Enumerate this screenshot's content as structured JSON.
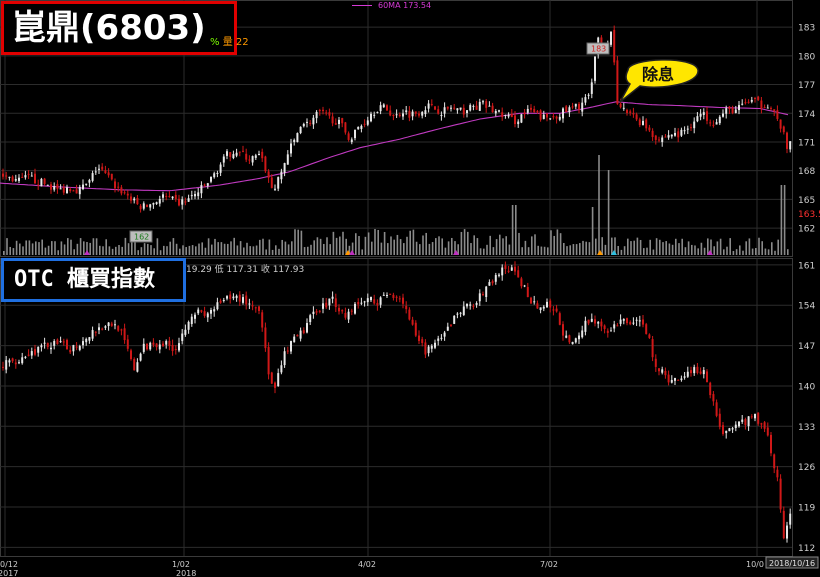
{
  "title_box": {
    "label": "崑鼎(6803)"
  },
  "otc_box": {
    "label": "OTC 櫃買指數"
  },
  "top_legend": {
    "ma_label": "60MA 173.54",
    "pct_symbol": "%",
    "vol_label": "量 22"
  },
  "otc_legend": {
    "text": "19.29 低 117.31 收 117.93"
  },
  "annotation": {
    "text": "除息"
  },
  "dates": {
    "x_labels": [
      "0/12",
      "1/02",
      "4/02",
      "7/02",
      "10/0"
    ],
    "x_year_labels": [
      "2017",
      "2018"
    ],
    "cursor_date": "2018/10/16"
  },
  "colors": {
    "up": "#e8e8e8",
    "down": "#d01818",
    "ma": "#c03ac0",
    "volume": "#8a8a8a",
    "grid": "#2c2c2c",
    "axis_text": "#cfcfcf"
  },
  "chart_data": [
    {
      "type": "candlestick",
      "name": "崑鼎(6803) daily",
      "ylim": [
        159.5,
        185
      ],
      "yticks": [
        162,
        165,
        168,
        171,
        174,
        177,
        180,
        183
      ],
      "price_tag": "163.5",
      "max_label": "183",
      "min_label": "162",
      "ma_label": "60MA 173.54",
      "close_points": [
        [
          0,
          167.6
        ],
        [
          10,
          167.2
        ],
        [
          18,
          166.9
        ],
        [
          28,
          167.3
        ],
        [
          38,
          166.8
        ],
        [
          48,
          166.5
        ],
        [
          58,
          165.9
        ],
        [
          68,
          166.3
        ],
        [
          78,
          166.0
        ],
        [
          88,
          166.7
        ],
        [
          96,
          168.4
        ],
        [
          106,
          167.4
        ],
        [
          116,
          166.2
        ],
        [
          126,
          165.5
        ],
        [
          134,
          164.6
        ],
        [
          140,
          164.2
        ],
        [
          146,
          164.3
        ],
        [
          154,
          164.8
        ],
        [
          162,
          165.3
        ],
        [
          170,
          164.9
        ],
        [
          178,
          164.6
        ],
        [
          186,
          164.9
        ],
        [
          194,
          165.5
        ],
        [
          202,
          166.2
        ],
        [
          210,
          167.1
        ],
        [
          218,
          168.4
        ],
        [
          226,
          169.6
        ],
        [
          234,
          170.2
        ],
        [
          242,
          169.6
        ],
        [
          250,
          169.2
        ],
        [
          258,
          169.5
        ],
        [
          264,
          168.4
        ],
        [
          270,
          166.2
        ],
        [
          276,
          166.5
        ],
        [
          282,
          168.4
        ],
        [
          288,
          170.1
        ],
        [
          294,
          171.2
        ],
        [
          300,
          173.1
        ],
        [
          306,
          172.9
        ],
        [
          312,
          173.4
        ],
        [
          318,
          174.1
        ],
        [
          326,
          173.6
        ],
        [
          334,
          173.3
        ],
        [
          342,
          172.5
        ],
        [
          350,
          171.2
        ],
        [
          356,
          172.4
        ],
        [
          362,
          172.9
        ],
        [
          370,
          174.0
        ],
        [
          378,
          174.7
        ],
        [
          386,
          174.4
        ],
        [
          394,
          173.6
        ],
        [
          402,
          174.3
        ],
        [
          410,
          173.9
        ],
        [
          418,
          174.2
        ],
        [
          426,
          174.8
        ],
        [
          434,
          174.5
        ],
        [
          442,
          174.2
        ],
        [
          450,
          174.6
        ],
        [
          458,
          174.1
        ],
        [
          466,
          174.4
        ],
        [
          474,
          174.7
        ],
        [
          482,
          174.9
        ],
        [
          490,
          174.4
        ],
        [
          498,
          174.0
        ],
        [
          506,
          173.6
        ],
        [
          514,
          173.2
        ],
        [
          522,
          173.9
        ],
        [
          530,
          174.2
        ],
        [
          538,
          173.7
        ],
        [
          546,
          173.4
        ],
        [
          554,
          173.8
        ],
        [
          562,
          174.1
        ],
        [
          570,
          174.4
        ],
        [
          578,
          174.8
        ],
        [
          584,
          175.4
        ],
        [
          588,
          175.8
        ],
        [
          591,
          176.9
        ],
        [
          593,
          178.5
        ],
        [
          596,
          182.2
        ],
        [
          600,
          181.5
        ],
        [
          604,
          180.8
        ],
        [
          609,
          182.4
        ],
        [
          612,
          181.9
        ],
        [
          616,
          174.6
        ],
        [
          622,
          174.3
        ],
        [
          628,
          173.9
        ],
        [
          634,
          173.5
        ],
        [
          640,
          173.1
        ],
        [
          646,
          172.6
        ],
        [
          652,
          171.8
        ],
        [
          658,
          171.3
        ],
        [
          664,
          171.5
        ],
        [
          670,
          171.9
        ],
        [
          676,
          171.6
        ],
        [
          682,
          172.1
        ],
        [
          688,
          172.6
        ],
        [
          694,
          173.4
        ],
        [
          700,
          173.9
        ],
        [
          706,
          173.6
        ],
        [
          712,
          173.2
        ],
        [
          718,
          173.5
        ],
        [
          724,
          174.1
        ],
        [
          730,
          174.4
        ],
        [
          736,
          174.3
        ],
        [
          742,
          174.9
        ],
        [
          748,
          175.3
        ],
        [
          754,
          175.2
        ],
        [
          760,
          174.8
        ],
        [
          766,
          175.1
        ],
        [
          772,
          174.4
        ],
        [
          776,
          173.2
        ],
        [
          780,
          172.6
        ],
        [
          783,
          171.5
        ],
        [
          786,
          170.2
        ],
        [
          790,
          171.0
        ]
      ],
      "ma60_points": [
        [
          0,
          166.7
        ],
        [
          60,
          166.3
        ],
        [
          120,
          166.0
        ],
        [
          170,
          165.9
        ],
        [
          220,
          166.5
        ],
        [
          260,
          167.2
        ],
        [
          290,
          167.9
        ],
        [
          330,
          169.4
        ],
        [
          360,
          170.4
        ],
        [
          400,
          171.3
        ],
        [
          440,
          172.4
        ],
        [
          480,
          173.4
        ],
        [
          520,
          174.0
        ],
        [
          560,
          174.0
        ],
        [
          590,
          174.6
        ],
        [
          616,
          175.2
        ],
        [
          650,
          174.9
        ],
        [
          680,
          174.8
        ],
        [
          720,
          174.6
        ],
        [
          760,
          174.5
        ],
        [
          790,
          173.8
        ]
      ],
      "volume_spikes": [
        [
          513,
          50
        ],
        [
          592,
          48
        ],
        [
          597,
          100
        ],
        [
          608,
          85
        ],
        [
          782,
          70
        ]
      ]
    },
    {
      "type": "candlestick",
      "name": "OTC 櫃買指數 daily",
      "ylim": [
        110.5,
        161.5
      ],
      "yticks": [
        112,
        119,
        126,
        133,
        140,
        147,
        154,
        161
      ],
      "close_points": [
        [
          0,
          143.5
        ],
        [
          10,
          144.2
        ],
        [
          20,
          144.9
        ],
        [
          30,
          145.8
        ],
        [
          40,
          146.5
        ],
        [
          50,
          147.3
        ],
        [
          60,
          147.0
        ],
        [
          70,
          146.5
        ],
        [
          80,
          147.6
        ],
        [
          90,
          149.4
        ],
        [
          100,
          150.3
        ],
        [
          110,
          150.8
        ],
        [
          118,
          150.3
        ],
        [
          124,
          147.0
        ],
        [
          128,
          145.8
        ],
        [
          132,
          142.4
        ],
        [
          136,
          144.3
        ],
        [
          142,
          146.5
        ],
        [
          150,
          147.3
        ],
        [
          158,
          147.6
        ],
        [
          166,
          147.1
        ],
        [
          174,
          146.6
        ],
        [
          180,
          148.3
        ],
        [
          188,
          152.1
        ],
        [
          196,
          152.9
        ],
        [
          204,
          151.9
        ],
        [
          212,
          153.4
        ],
        [
          220,
          154.3
        ],
        [
          228,
          155.1
        ],
        [
          236,
          155.4
        ],
        [
          244,
          154.8
        ],
        [
          252,
          153.9
        ],
        [
          258,
          153.2
        ],
        [
          262,
          150.2
        ],
        [
          266,
          143.3
        ],
        [
          270,
          140.6
        ],
        [
          274,
          138.9
        ],
        [
          278,
          142.3
        ],
        [
          284,
          145.6
        ],
        [
          292,
          147.6
        ],
        [
          300,
          149.1
        ],
        [
          308,
          151.1
        ],
        [
          316,
          153.6
        ],
        [
          324,
          154.1
        ],
        [
          332,
          155.1
        ],
        [
          338,
          153.6
        ],
        [
          344,
          151.9
        ],
        [
          350,
          153.4
        ],
        [
          358,
          154.3
        ],
        [
          366,
          155.1
        ],
        [
          374,
          154.6
        ],
        [
          382,
          155.1
        ],
        [
          390,
          156.1
        ],
        [
          398,
          155.6
        ],
        [
          404,
          154.1
        ],
        [
          410,
          150.8
        ],
        [
          416,
          147.6
        ],
        [
          424,
          146.2
        ],
        [
          432,
          146.8
        ],
        [
          440,
          147.8
        ],
        [
          448,
          150.3
        ],
        [
          456,
          152.7
        ],
        [
          464,
          153.4
        ],
        [
          472,
          154.5
        ],
        [
          480,
          155.5
        ],
        [
          488,
          157.5
        ],
        [
          496,
          159.3
        ],
        [
          504,
          160.3
        ],
        [
          510,
          160.1
        ],
        [
          516,
          159.0
        ],
        [
          522,
          157.3
        ],
        [
          530,
          155.1
        ],
        [
          538,
          153.6
        ],
        [
          546,
          153.9
        ],
        [
          552,
          153.4
        ],
        [
          558,
          151.6
        ],
        [
          564,
          148.3
        ],
        [
          570,
          146.7
        ],
        [
          576,
          148.3
        ],
        [
          582,
          150.3
        ],
        [
          588,
          151.4
        ],
        [
          594,
          151.6
        ],
        [
          600,
          150.3
        ],
        [
          606,
          148.5
        ],
        [
          612,
          150.0
        ],
        [
          618,
          150.8
        ],
        [
          624,
          151.6
        ],
        [
          630,
          151.1
        ],
        [
          636,
          150.8
        ],
        [
          642,
          151.2
        ],
        [
          646,
          149.3
        ],
        [
          650,
          146.8
        ],
        [
          654,
          144.1
        ],
        [
          660,
          142.3
        ],
        [
          666,
          141.3
        ],
        [
          672,
          140.8
        ],
        [
          680,
          141.6
        ],
        [
          688,
          142.5
        ],
        [
          694,
          143.3
        ],
        [
          700,
          142.6
        ],
        [
          706,
          141.3
        ],
        [
          710,
          138.6
        ],
        [
          714,
          136.3
        ],
        [
          718,
          133.2
        ],
        [
          722,
          132.0
        ],
        [
          728,
          132.3
        ],
        [
          734,
          133.1
        ],
        [
          740,
          133.8
        ],
        [
          746,
          134.0
        ],
        [
          752,
          134.4
        ],
        [
          758,
          134.2
        ],
        [
          764,
          132.8
        ],
        [
          768,
          130.5
        ],
        [
          772,
          126.9
        ],
        [
          776,
          124.1
        ],
        [
          779,
          120.1
        ],
        [
          782,
          113.5
        ],
        [
          786,
          115.2
        ],
        [
          790,
          117.9
        ]
      ]
    }
  ]
}
